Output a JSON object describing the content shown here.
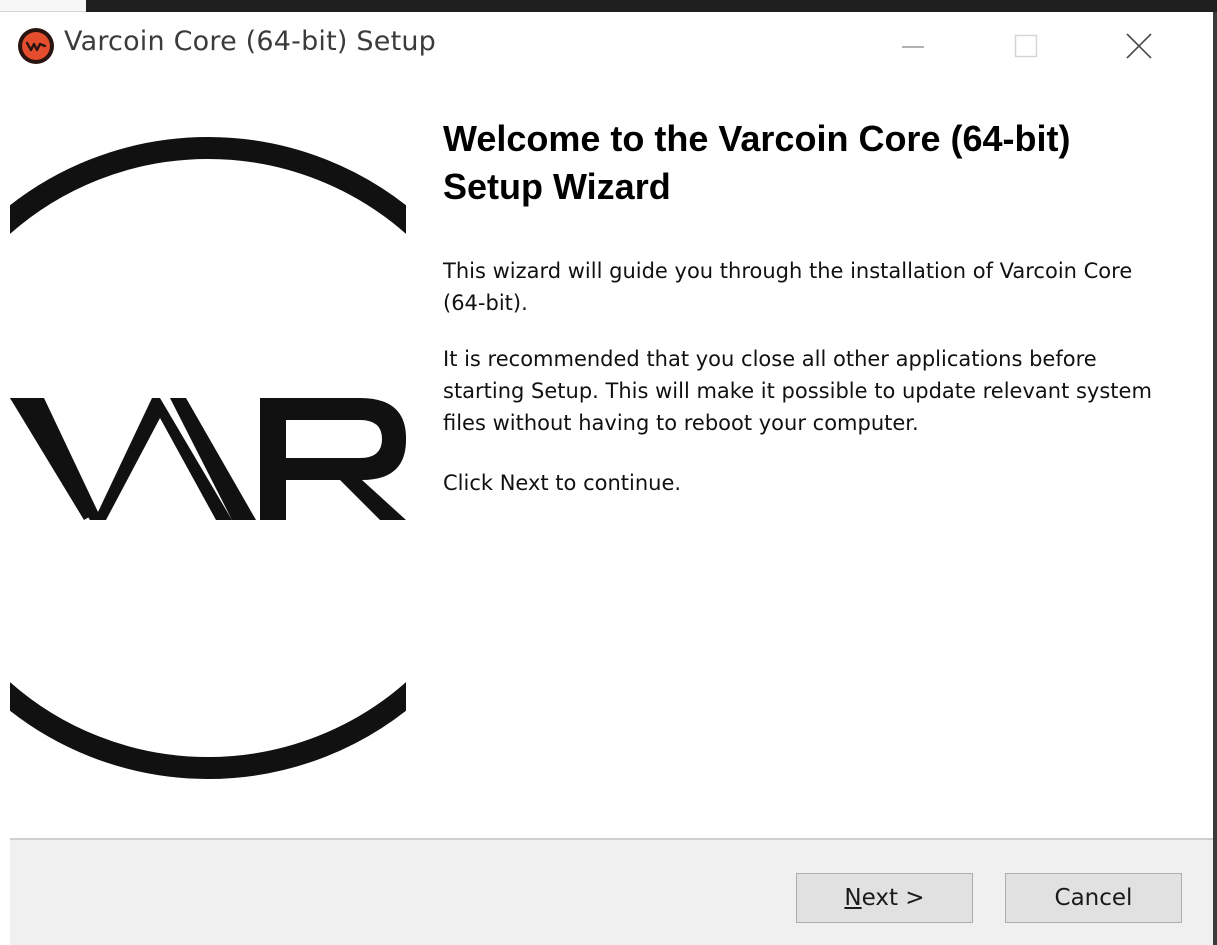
{
  "window": {
    "title": "Varcoin Core (64-bit) Setup",
    "controls": {
      "minimize_icon": "minimize-icon",
      "maximize_icon": "maximize-icon",
      "close_icon": "close-icon"
    },
    "app_icon": "varcoin-app-icon"
  },
  "banner": {
    "logo_text": "VAR",
    "logo_name": "varcoin-logo"
  },
  "content": {
    "heading": "Welcome to the Varcoin Core (64-bit) Setup Wizard",
    "paragraph_1": "This wizard will guide you through the installation of Varcoin Core (64-bit).",
    "paragraph_2": "It is recommended that you close all other applications before starting Setup. This will make it possible to update relevant system files without having to reboot your computer.",
    "paragraph_3": "Click Next to continue."
  },
  "footer": {
    "next_label_mnemonic": "N",
    "next_label_rest": "ext >",
    "cancel_label": "Cancel"
  },
  "colors": {
    "icon_accent": "#e44d2e",
    "icon_dark": "#2a1410",
    "footer_bg": "#f0f0f0",
    "button_bg": "#e1e1e1",
    "button_border": "#adadad"
  }
}
